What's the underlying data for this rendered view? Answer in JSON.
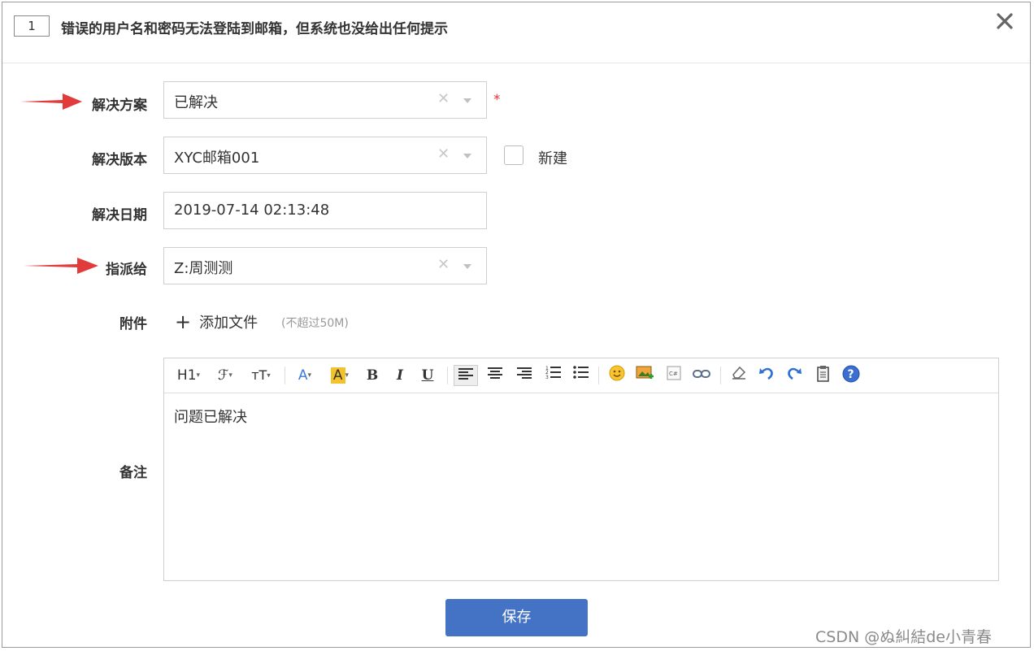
{
  "header": {
    "id": "1",
    "title": "错误的用户名和密码无法登陆到邮箱，但系统也没给出任何提示",
    "close_icon": "close-icon"
  },
  "form": {
    "resolution": {
      "label": "解决方案",
      "value": "已解决",
      "required_mark": "*"
    },
    "build": {
      "label": "解决版本",
      "value": "XYC邮箱001",
      "new_label": "新建",
      "new_checked": false
    },
    "date": {
      "label": "解决日期",
      "value": "2019-07-14 02:13:48"
    },
    "assign": {
      "label": "指派给",
      "value": "Z:周测测"
    },
    "attachment": {
      "label": "附件",
      "add_text": "添加文件",
      "limit": "(不超过50M)"
    },
    "notes": {
      "label": "备注",
      "content": "问题已解决",
      "toolbar": {
        "h1": "H1",
        "font": "ℱ",
        "size": "тT",
        "font_color": "A",
        "bg_color": "A",
        "bold": "B",
        "italic": "I",
        "underline": "U"
      }
    }
  },
  "save_button": "保存",
  "watermark": "CSDN @ぬ糾結de小青春",
  "colors": {
    "primary": "#4472c4",
    "arrow": "#e23b3b",
    "required": "#e33333"
  }
}
